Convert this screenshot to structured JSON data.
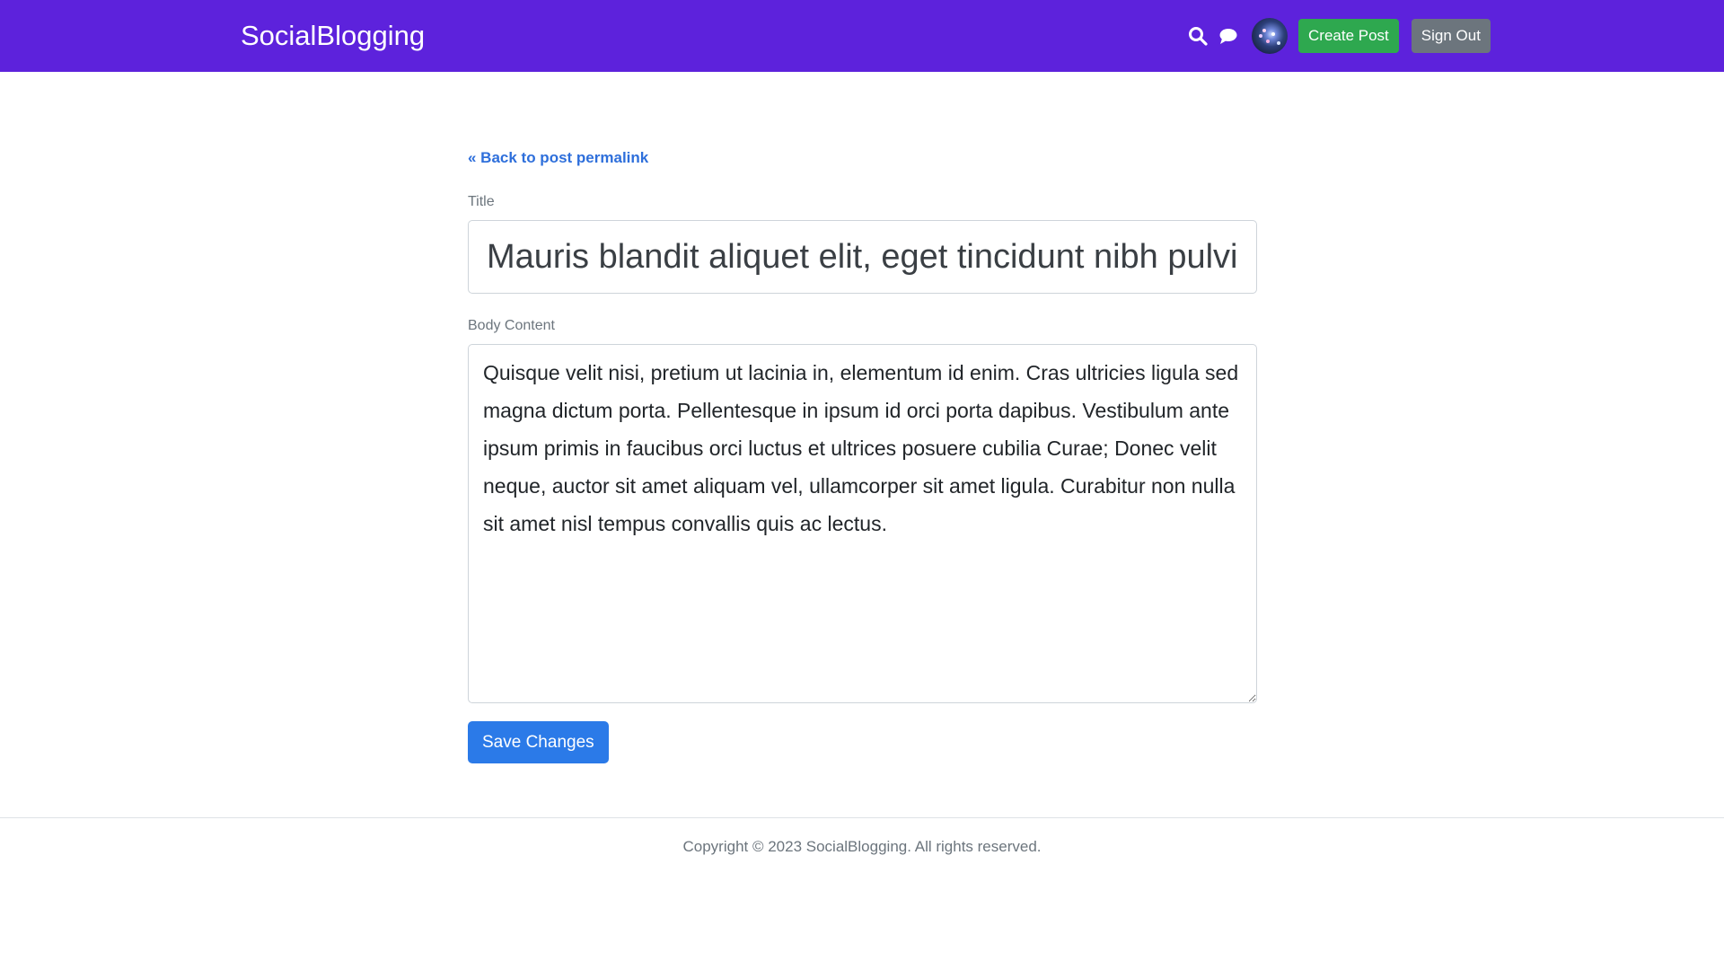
{
  "header": {
    "brand": "SocialBlogging",
    "icons": [
      "search-icon",
      "chat-icon"
    ],
    "create_label": "Create Post",
    "signout_label": "Sign Out",
    "colors": {
      "bar": "#5d22dc",
      "create": "#2ea84f",
      "signout": "#6c757d"
    }
  },
  "main": {
    "back_link": "« Back to post permalink",
    "title_label": "Title",
    "title_value": "Mauris blandit aliquet elit, eget tincidunt nibh pulvinar a.",
    "body_label": "Body Content",
    "body_value": "Quisque velit nisi, pretium ut lacinia in, elementum id enim. Cras ultricies ligula sed magna dictum porta. Pellentesque in ipsum id orci porta dapibus. Vestibulum ante ipsum primis in faucibus orci luctus et ultrices posuere cubilia Curae; Donec velit neque, auctor sit amet aliquam vel, ullamcorper sit amet ligula. Curabitur non nulla sit amet nisl tempus convallis quis ac lectus.",
    "save_label": "Save Changes",
    "colors": {
      "link": "#2e6fdb",
      "save": "#2b7ae8"
    }
  },
  "footer": {
    "text": "Copyright © 2023 SocialBlogging. All rights reserved."
  }
}
